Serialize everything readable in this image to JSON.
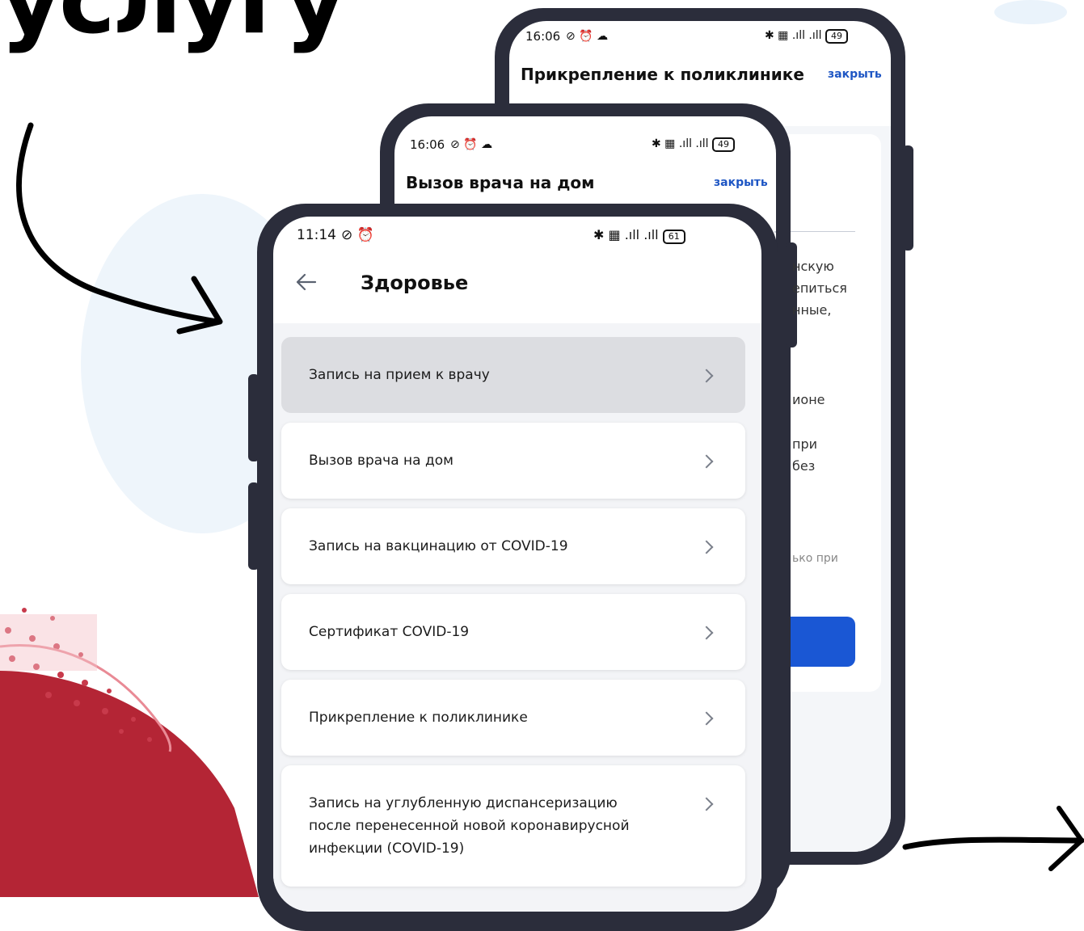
{
  "headline": "услугу",
  "colors": {
    "accent": "#1e56c4",
    "blue_button": "#1a57d4",
    "phone_frame": "#2b2d3b",
    "active_item": "#dcdde1",
    "red_blob": "#b42535"
  },
  "phone_back": {
    "status_time": "16:06",
    "status_battery": "49",
    "title": "Прикрепление к поликлинике",
    "close_label": "закрыть"
  },
  "phone_middle": {
    "status_time": "16:06",
    "status_battery": "49",
    "title": "Вызов врача на дом",
    "close_label": "закрыть",
    "fragments": [
      "нскую",
      "епиться",
      "нные,",
      "ионе",
      "при",
      "без",
      "ько при"
    ]
  },
  "phone_front": {
    "status_time": "11:14",
    "status_battery": "61",
    "back_icon": "arrow-left-icon",
    "title": "Здоровье",
    "items": [
      {
        "label": "Запись на прием к врачу"
      },
      {
        "label": "Вызов врача на дом"
      },
      {
        "label": "Запись на вакцинацию от COVID-19"
      },
      {
        "label": "Сертификат COVID-19"
      },
      {
        "label": "Прикрепление к поликлинике"
      },
      {
        "label_lines": [
          "Запись на углубленную диспансеризацию",
          "после перенесенной новой коронавирусной",
          "инфекции (COVID-19)"
        ]
      }
    ]
  }
}
